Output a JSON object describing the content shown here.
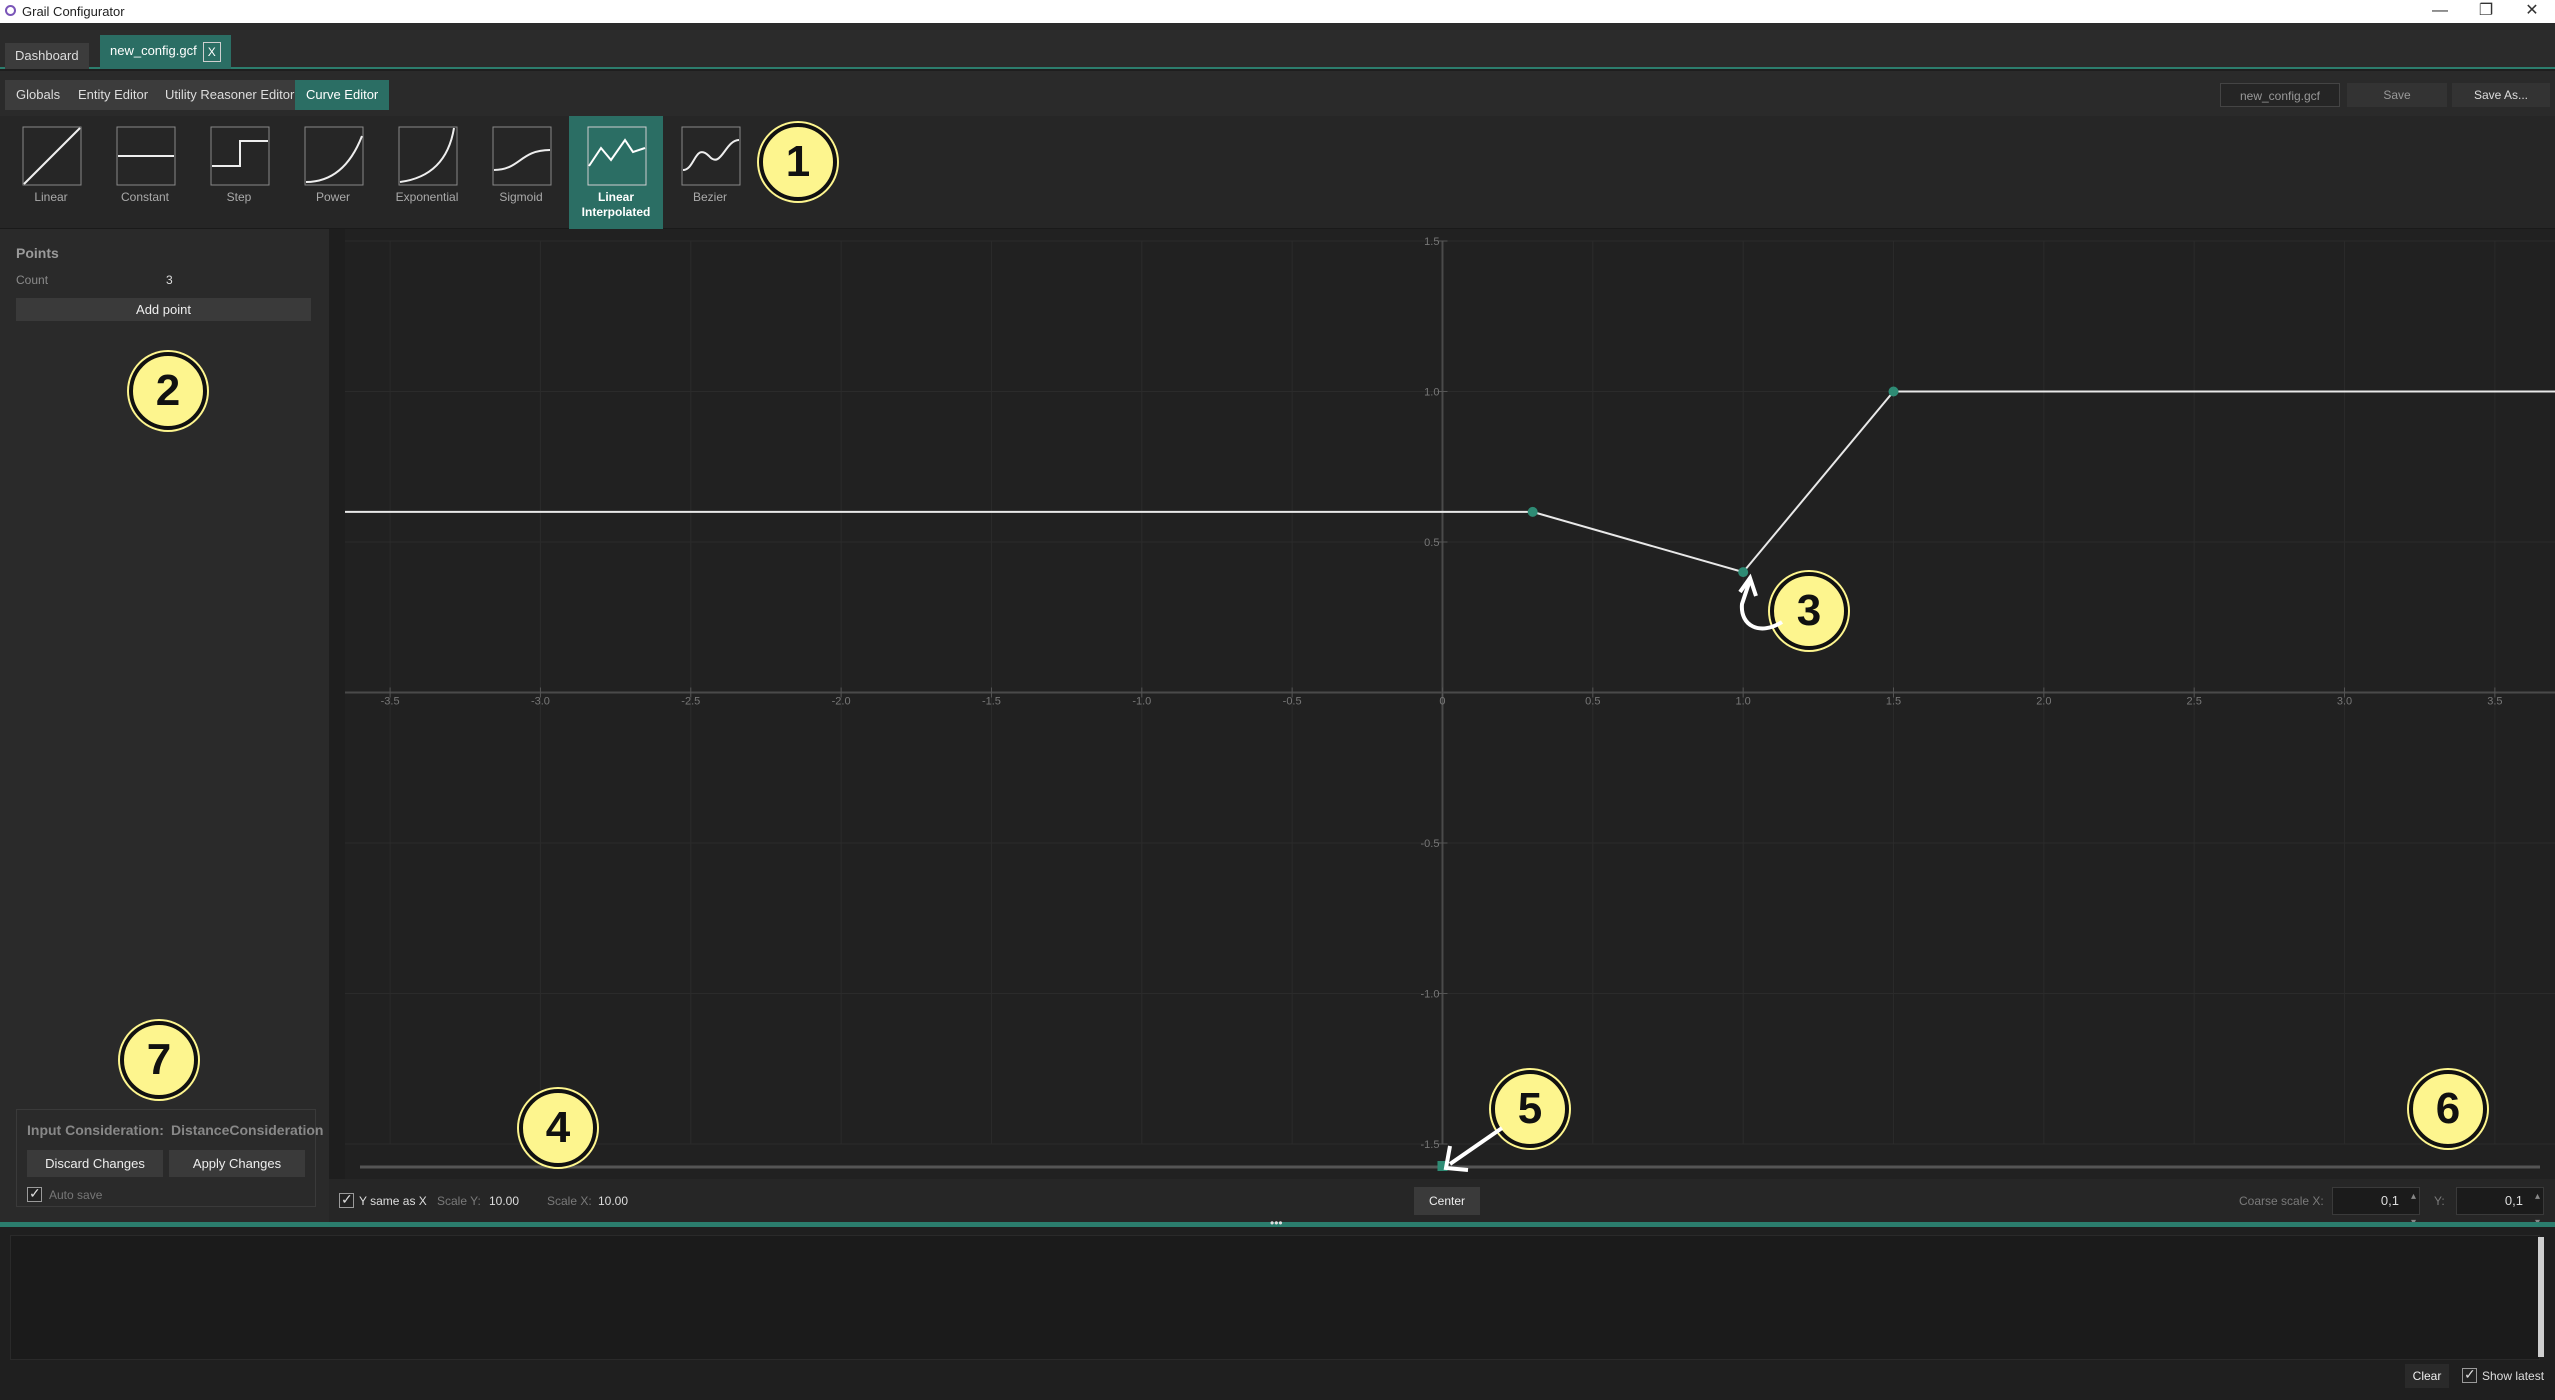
{
  "window": {
    "title": "Grail Configurator",
    "min": "—",
    "restore": "❐",
    "close": "✕"
  },
  "doc_tabs": [
    {
      "label": "Dashboard"
    },
    {
      "label": "new_config.gcf",
      "close": "X"
    }
  ],
  "toolbar": {
    "tabs": [
      "Globals",
      "Entity Editor",
      "Utility Reasoner Editor",
      "Curve Editor"
    ],
    "active_tab": "Curve Editor",
    "filename_field": "new_config.gcf",
    "save_label": "Save",
    "save_as_label": "Save As..."
  },
  "curve_types": [
    {
      "label": "Linear",
      "icon": "linear-curve-icon"
    },
    {
      "label": "Constant",
      "icon": "constant-curve-icon"
    },
    {
      "label": "Step",
      "icon": "step-curve-icon"
    },
    {
      "label": "Power",
      "icon": "power-curve-icon"
    },
    {
      "label": "Exponential",
      "icon": "exponential-curve-icon"
    },
    {
      "label": "Sigmoid",
      "icon": "sigmoid-curve-icon"
    },
    {
      "label": "Linear Interpolated",
      "icon": "linear-interpolated-curve-icon",
      "active": true
    },
    {
      "label": "Bezier",
      "icon": "bezier-curve-icon"
    }
  ],
  "points_panel": {
    "heading": "Points",
    "count_label": "Count",
    "count_value": "3",
    "add_point_label": "Add point"
  },
  "consideration_panel": {
    "input_label": "Input Consideration:",
    "input_value": "DistanceConsideration",
    "discard_label": "Discard Changes",
    "apply_label": "Apply Changes",
    "autosave_label": "Auto save",
    "autosave_checked": true
  },
  "chart_data": {
    "type": "line",
    "x_ticks": [
      "-3.5",
      "-3.0",
      "-2.5",
      "-2.0",
      "-1.5",
      "-1.0",
      "-0.5",
      "0",
      "0.5",
      "1.0",
      "1.5",
      "2.0",
      "2.5",
      "3.0",
      "3.5"
    ],
    "y_ticks": [
      "1.5",
      "1.0",
      "0.5",
      "-0.5",
      "-1.0",
      "-1.5"
    ],
    "xlim": [
      -3.65,
      3.7
    ],
    "ylim": [
      -1.5,
      1.5
    ],
    "grid": true,
    "points": [
      {
        "x": 0.3,
        "y": 0.6
      },
      {
        "x": 1.0,
        "y": 0.4
      },
      {
        "x": 1.5,
        "y": 1.0
      }
    ],
    "line_color": "#e8e8e8",
    "point_color": "#2e8b74"
  },
  "scale_bar": {
    "y_same_as_x_label": "Y same as X",
    "y_same_as_x_checked": true,
    "scale_y_label": "Scale Y:",
    "scale_y_value": "10.00",
    "scale_x_label": "Scale X:",
    "scale_x_value": "10.00",
    "center_label": "Center",
    "coarse_x_label": "Coarse scale X:",
    "coarse_x_value": "0,1",
    "coarse_y_label": "Y:",
    "coarse_y_value": "0,1"
  },
  "log": {
    "clear_label": "Clear",
    "show_latest_label": "Show latest",
    "show_latest_checked": true
  },
  "callouts": [
    "1",
    "2",
    "3",
    "4",
    "5",
    "6",
    "7"
  ],
  "colors": {
    "accent": "#2b6e64",
    "callout": "#fdf58e"
  }
}
